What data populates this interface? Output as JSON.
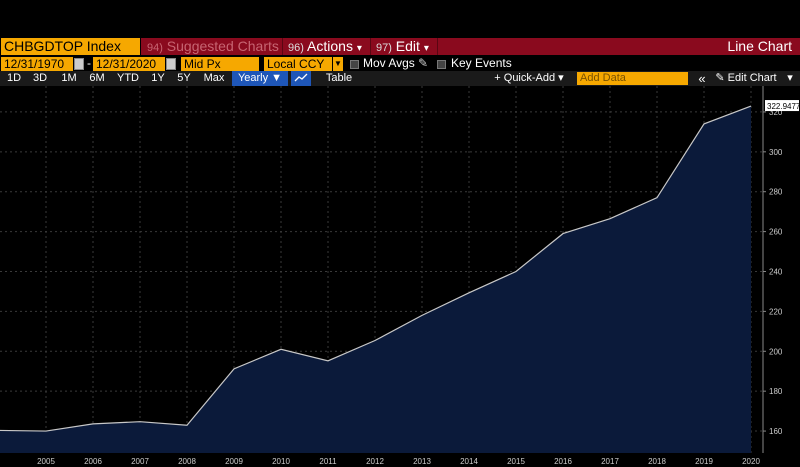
{
  "header": {
    "ticker": "CHBGDTOP Index",
    "suggested": {
      "num": "94)",
      "label": "Suggested Charts"
    },
    "actions": {
      "num": "96)",
      "label": "Actions",
      "arrow": "▾"
    },
    "edit": {
      "num": "97)",
      "label": "Edit",
      "arrow": "▾"
    },
    "title": "Line Chart"
  },
  "controls": {
    "start_date": "12/31/1970",
    "end_date": "12/31/2020",
    "dash": "-",
    "price_field": "Mid Px",
    "currency": "Local CCY",
    "mov_avgs": "Mov Avgs",
    "key_events": "Key Events"
  },
  "toolbar": {
    "periods": [
      "1D",
      "3D",
      "1M",
      "6M",
      "YTD",
      "1Y",
      "5Y",
      "Max"
    ],
    "frequency": "Yearly ▼",
    "table": "Table",
    "quick_add": "+ Quick-Add ▾",
    "add_placeholder": "Add Data",
    "collapse": "«",
    "edit_chart": "✎ Edit Chart",
    "more": "▾"
  },
  "colors": {
    "accent": "#f6a800",
    "menu_bar": "#8a0a1e",
    "active": "#1e56b8",
    "area_fill": "#0b1a3a",
    "line": "#c8c8c8"
  },
  "chart_data": {
    "type": "area",
    "x": [
      2004,
      2005,
      2006,
      2007,
      2008,
      2009,
      2010,
      2011,
      2012,
      2013,
      2014,
      2015,
      2016,
      2017,
      2018,
      2019,
      2020
    ],
    "values": [
      160.3,
      160.0,
      163.6,
      164.7,
      162.9,
      191.2,
      201.0,
      195.2,
      205.4,
      218.0,
      229.3,
      240.0,
      259.0,
      266.5,
      277.0,
      314.0,
      322.9477
    ],
    "xticks": [
      2005,
      2006,
      2007,
      2008,
      2009,
      2010,
      2011,
      2012,
      2013,
      2014,
      2015,
      2016,
      2017,
      2018,
      2019,
      2020
    ],
    "yticks": [
      160,
      180,
      200,
      220,
      240,
      260,
      280,
      300,
      320
    ],
    "ylim": [
      149,
      333
    ],
    "last_value_label": "322.9477",
    "grid": true
  }
}
